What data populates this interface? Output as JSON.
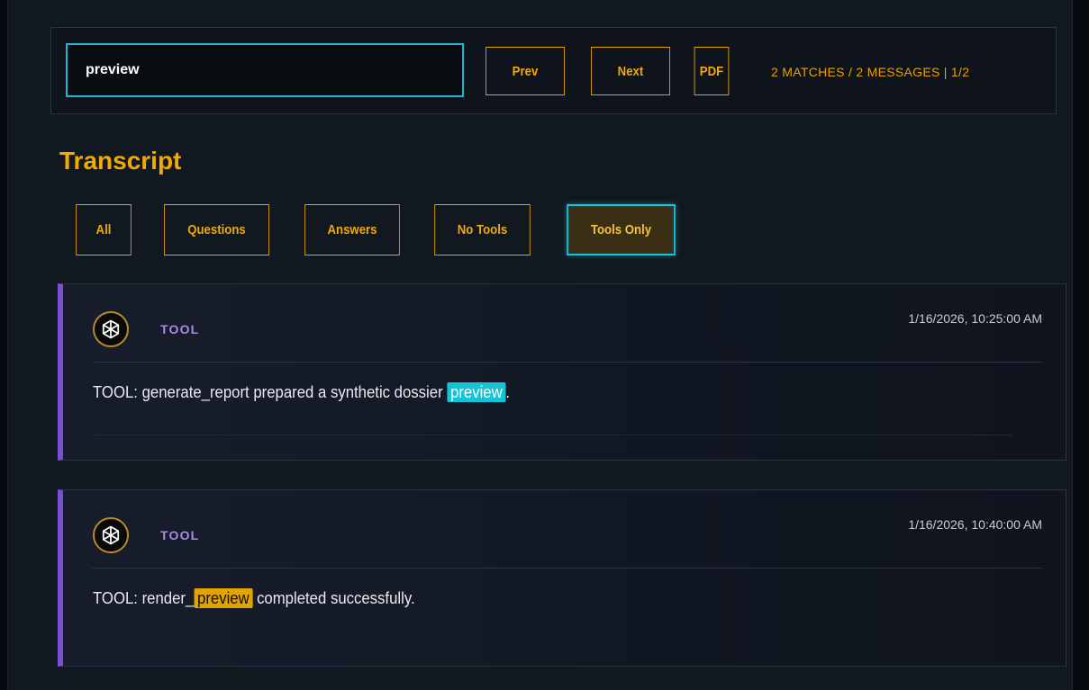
{
  "search": {
    "value": "preview",
    "prev_label": "Prev",
    "next_label": "Next",
    "pdf_label": "PDF",
    "match_status": "2 MATCHES / 2 MESSAGES | 1/2"
  },
  "transcript": {
    "title": "Transcript",
    "filters": [
      "All",
      "Questions",
      "Answers",
      "No Tools",
      "Tools Only"
    ],
    "active_filter": "Tools Only"
  },
  "messages": [
    {
      "role": "TOOL",
      "timestamp": "1/16/2026, 10:25:00 AM",
      "text_before": "TOOL: generate_report prepared a synthetic dossier ",
      "highlight": "preview",
      "text_after": ".",
      "highlight_style": "current-match",
      "avatar_icon": "openai-logo-icon"
    },
    {
      "role": "TOOL",
      "timestamp": "1/16/2026, 10:40:00 AM",
      "text_before": "TOOL: render_",
      "highlight": "preview",
      "text_after": " completed successfully.",
      "highlight_style": "match",
      "avatar_icon": "openai-logo-icon"
    }
  ],
  "colors": {
    "accent_gold": "#f2a900",
    "accent_cyan": "#18c6e0",
    "role_purple": "#a98ae8",
    "card_border_purple": "#7b4fd6"
  }
}
